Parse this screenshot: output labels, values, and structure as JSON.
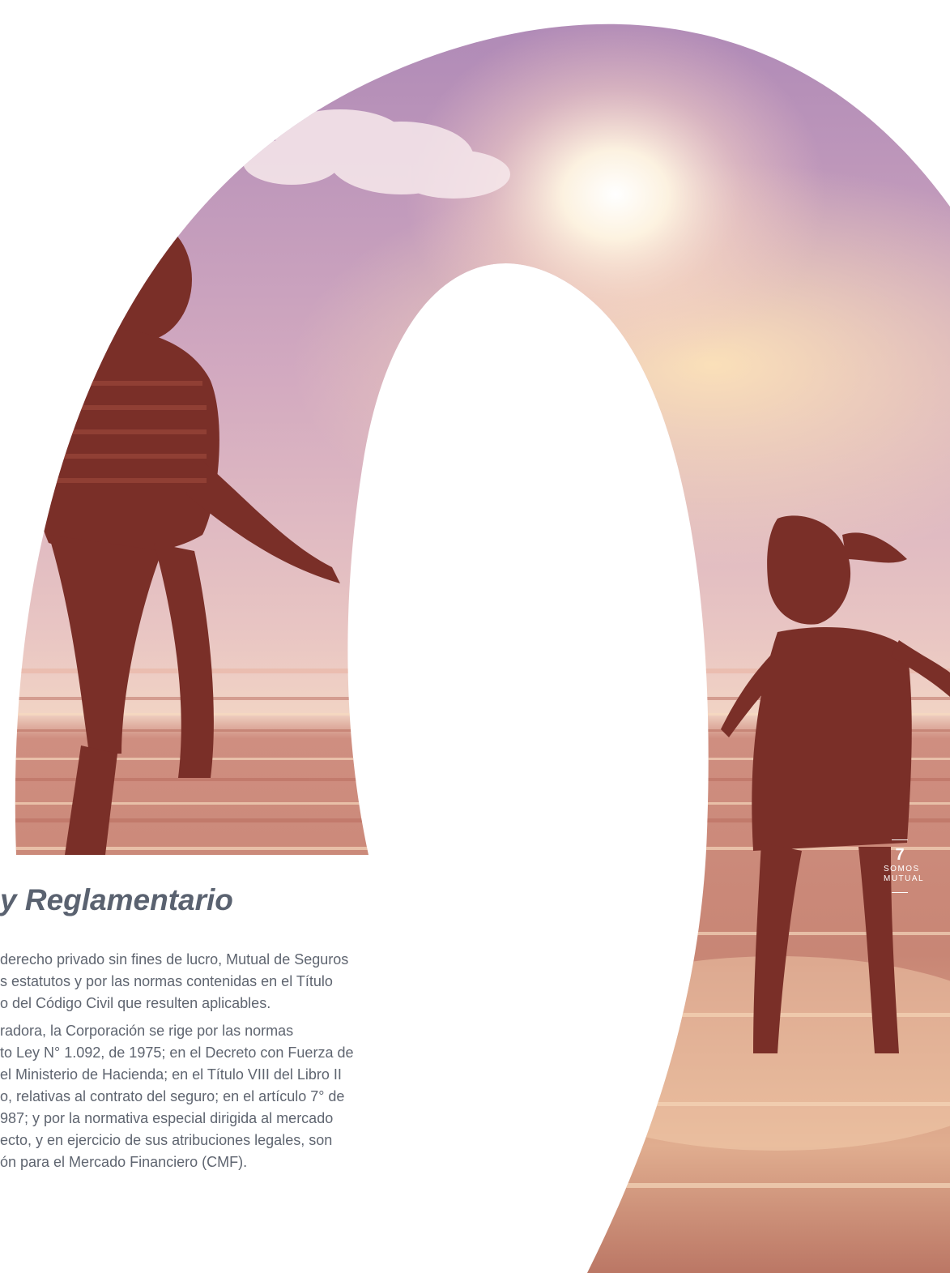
{
  "heading": "y Reglamentario",
  "paragraphs": [
    [
      "derecho privado sin fines de lucro, Mutual de Seguros",
      "s estatutos y por las normas contenidas en el Título",
      "o del Código Civil que resulten aplicables."
    ],
    [
      "radora, la Corporación se rige por las normas",
      "to Ley N° 1.092, de 1975; en el Decreto con Fuerza de",
      "el Ministerio de Hacienda; en el Título VIII del Libro II",
      "o, relativas al contrato del seguro; en el artículo 7° de",
      "987; y por la normativa especial dirigida al mercado",
      "ecto, y en ejercicio de sus atribuciones legales, son",
      "ón para el Mercado Financiero (CMF)."
    ]
  ],
  "page_marker": {
    "number": "7",
    "section_line_1": "SOMOS",
    "section_line_2": "MUTUAL"
  },
  "colors": {
    "text": "#5f6570",
    "heading": "#5a6270",
    "sky_top": "#b089b6",
    "sun": "#fff6dc",
    "sea": "#c98a78"
  }
}
